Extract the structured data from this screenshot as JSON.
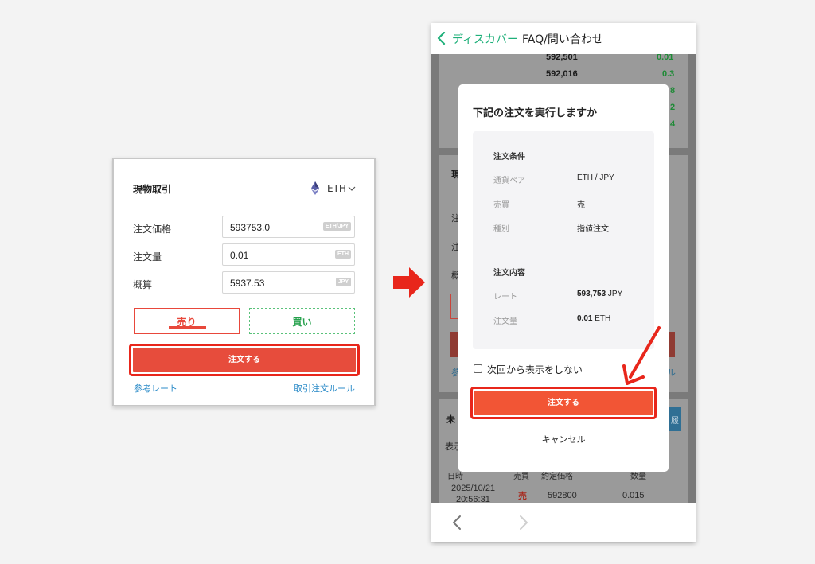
{
  "colors": {
    "sell_red": "#e8483b",
    "buy_green": "#26a14d",
    "link_blue": "#2b8bc8",
    "highlight_red": "#e8261b",
    "header_green": "#1fb07a",
    "order_button": "#f25535"
  },
  "left": {
    "title": "現物取引",
    "coin_icon": "ethereum-icon",
    "coin": "ETH",
    "fields": [
      {
        "label": "注文価格",
        "value": "593753.0",
        "unit": "ETH/JPY"
      },
      {
        "label": "注文量",
        "value": "0.01",
        "unit": "ETH"
      },
      {
        "label": "概算",
        "value": "5937.53",
        "unit": "JPY"
      }
    ],
    "sell_label": "売り",
    "buy_label": "買い",
    "order_button": "注文する",
    "ref_rate_link": "参考レート",
    "rules_link": "取引注文ルール"
  },
  "phone": {
    "header": {
      "back_label": "ディスカバー",
      "title": "FAQ/問い合わせ"
    },
    "background": {
      "book_rows": [
        {
          "price": "592,501",
          "qty": "0.01"
        },
        {
          "price": "592,016",
          "qty": "0.3"
        }
      ],
      "peek_qty": [
        "8",
        "2",
        "4"
      ],
      "peek_left_char": "現",
      "peek_labels": [
        "注",
        "注",
        "概"
      ],
      "peek_ref": "参",
      "peek_rule": "ル",
      "peek_pending": "未",
      "peek_display": "表示",
      "peek_history": "履",
      "table_header_peek": [
        "日時",
        "売買",
        "約定価格",
        "数量"
      ],
      "row": {
        "date": "2025/10/21",
        "time": "20:56:31",
        "side": "売",
        "price": "592800",
        "qty": "0.015"
      }
    }
  },
  "modal": {
    "title": "下記の注文を実行しますか",
    "conditions_heading": "注文条件",
    "conditions": [
      {
        "key": "通貨ペア",
        "value": "ETH / JPY"
      },
      {
        "key": "売買",
        "value": "売"
      },
      {
        "key": "種別",
        "value": "指値注文"
      }
    ],
    "details_heading": "注文内容",
    "details": [
      {
        "key": "レート",
        "value_bold": "593,753",
        "value_unit": " JPY"
      },
      {
        "key": "注文量",
        "value_bold": "0.01",
        "value_unit": " ETH"
      }
    ],
    "dont_show_label": "次回から表示をしない",
    "order_button": "注文する",
    "cancel_button": "キャンセル"
  }
}
